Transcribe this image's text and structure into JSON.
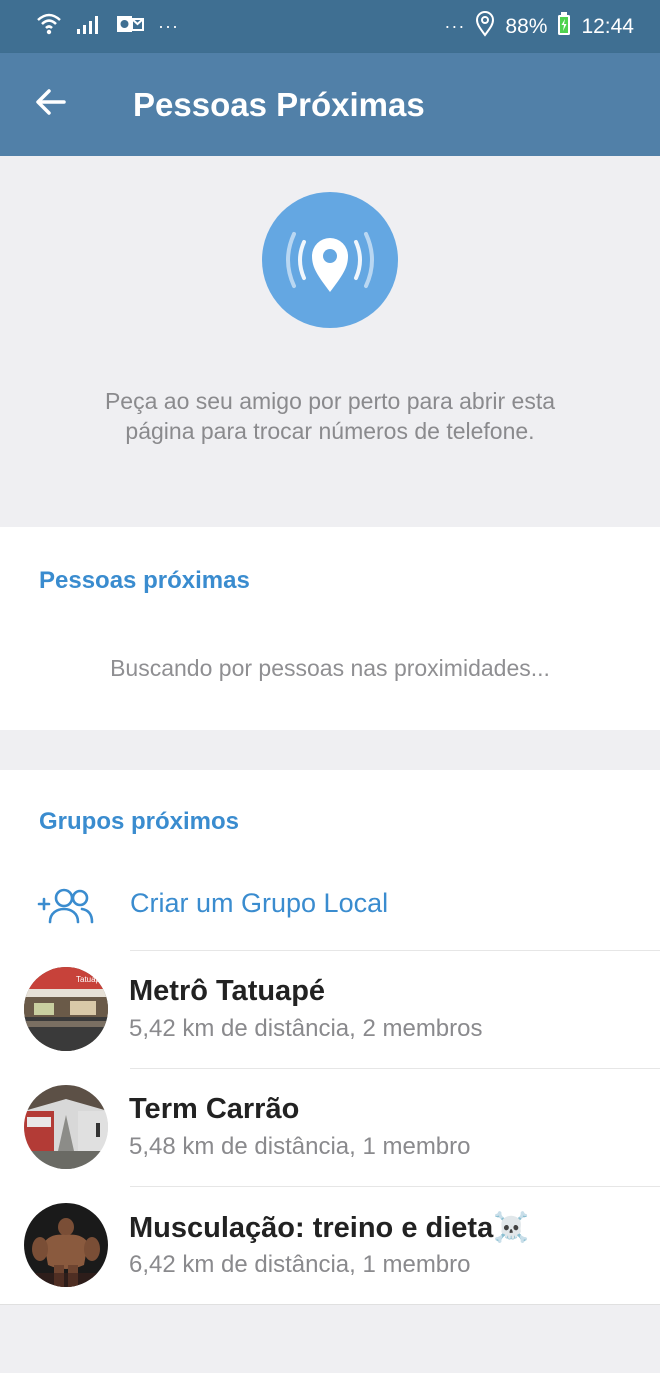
{
  "status_bar": {
    "left_icons": [
      "wifi-icon",
      "signal-icon",
      "outlook-icon"
    ],
    "left_more": "···",
    "right_more": "···",
    "battery": "88%",
    "time": "12:44"
  },
  "app_bar": {
    "title": "Pessoas Próximas",
    "back_icon": "arrow-left-icon"
  },
  "hero": {
    "icon": "location-broadcast-icon",
    "description": "Peça ao seu amigo por perto para abrir esta página para trocar números de telefone."
  },
  "people_section": {
    "header": "Pessoas próximas",
    "status": "Buscando por pessoas nas proximidades..."
  },
  "groups_section": {
    "header": "Grupos próximos",
    "create_label": "Criar um Grupo Local",
    "items": [
      {
        "name": "Metrô Tatuapé",
        "meta": "5,42 km de distância, 2 membros",
        "avatar_text": "Tatuapé"
      },
      {
        "name": "Term Carrão",
        "meta": "5,48 km de distância, 1 membro"
      },
      {
        "name": "Musculação: treino e dieta☠️",
        "meta": "6,42 km de distância, 1 membro"
      }
    ]
  },
  "colors": {
    "status_bar": "#3f6f92",
    "app_bar": "#5180a8",
    "accent": "#3a8ccf",
    "hero_circle": "#64a7e2",
    "background": "#efeff2"
  }
}
